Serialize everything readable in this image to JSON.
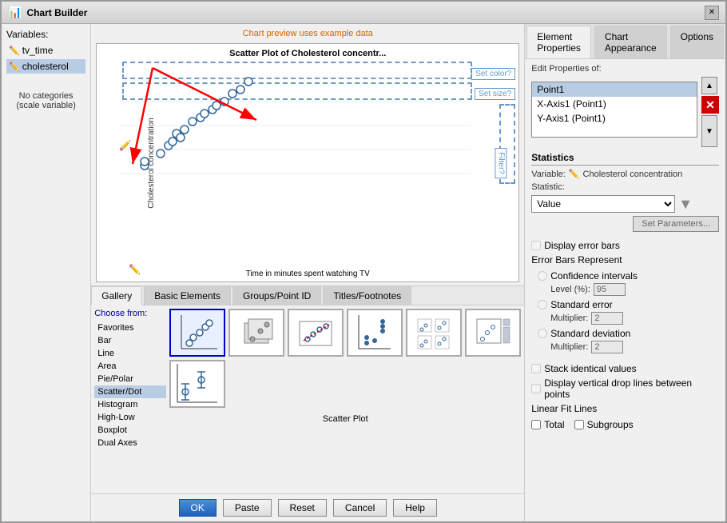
{
  "window": {
    "title": "Chart Builder",
    "icon": "📊"
  },
  "left_panel": {
    "variables_label": "Variables:",
    "variables": [
      {
        "name": "tv_time",
        "icon": "✏️",
        "selected": false
      },
      {
        "name": "cholesterol",
        "icon": "✏️",
        "selected": true
      }
    ],
    "no_categories": "No categories (scale variable)"
  },
  "chart_preview": {
    "label": "Chart preview uses example data",
    "title": "Scatter Plot of Cholesterol concentr...",
    "y_axis_label": "Cholesterol concentration",
    "x_axis_label": "Time in minutes spent\nwatching TV",
    "set_color": "Set color?",
    "set_size": "Set size?",
    "filter": "Filter?"
  },
  "tabs": {
    "items": [
      {
        "label": "Gallery",
        "active": true
      },
      {
        "label": "Basic Elements",
        "active": false
      },
      {
        "label": "Groups/Point ID",
        "active": false
      },
      {
        "label": "Titles/Footnotes",
        "active": false
      }
    ]
  },
  "gallery": {
    "choose_from": "Choose from:",
    "categories": [
      {
        "label": "Favorites",
        "selected": false
      },
      {
        "label": "Bar",
        "selected": false
      },
      {
        "label": "Line",
        "selected": false
      },
      {
        "label": "Area",
        "selected": false
      },
      {
        "label": "Pie/Polar",
        "selected": false
      },
      {
        "label": "Scatter/Dot",
        "selected": true
      },
      {
        "label": "Histogram",
        "selected": false
      },
      {
        "label": "High-Low",
        "selected": false
      },
      {
        "label": "Boxplot",
        "selected": false
      },
      {
        "label": "Dual Axes",
        "selected": false
      }
    ],
    "selected_label": "Scatter Plot"
  },
  "buttons": {
    "ok": "OK",
    "paste": "Paste",
    "reset": "Reset",
    "cancel": "Cancel",
    "help": "Help"
  },
  "right_panel": {
    "tabs": [
      {
        "label": "Element Properties",
        "active": true
      },
      {
        "label": "Chart Appearance",
        "active": false
      },
      {
        "label": "Options",
        "active": false
      }
    ],
    "edit_props_label": "Edit Properties of:",
    "props_list": [
      {
        "label": "Point1",
        "selected": true
      },
      {
        "label": "X-Axis1 (Point1)",
        "selected": false
      },
      {
        "label": "Y-Axis1 (Point1)",
        "selected": false
      }
    ],
    "statistics_header": "Statistics",
    "variable_label": "Variable:",
    "variable_value": "Cholesterol concentration",
    "statistic_label": "Statistic:",
    "statistic_value": "Value",
    "set_params_btn": "Set Parameters...",
    "display_error_bars": "Display error bars",
    "error_bars_header": "Error Bars Represent",
    "confidence_intervals": "Confidence intervals",
    "level_label": "Level (%):",
    "level_value": "95",
    "standard_error": "Standard error",
    "multiplier_label": "Multiplier:",
    "multiplier_value1": "2",
    "standard_deviation": "Standard deviation",
    "multiplier_value2": "2",
    "stack_identical": "Stack identical values",
    "display_drop_lines": "Display vertical drop lines between points",
    "linear_fit_header": "Linear Fit Lines",
    "total_label": "Total",
    "subgroups_label": "Subgroups"
  }
}
